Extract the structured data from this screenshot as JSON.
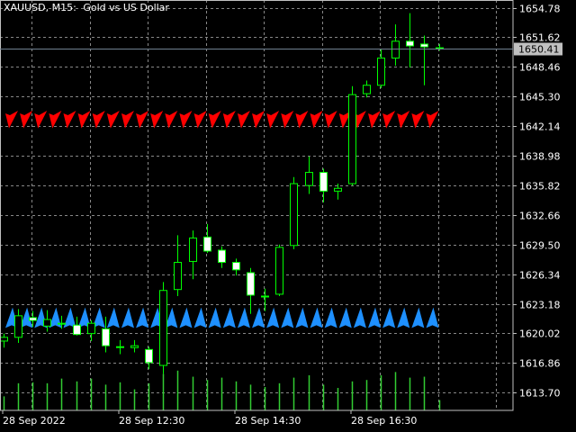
{
  "header": {
    "symbol": "XAUUSD, M15:",
    "description": "Gold vs US Dollar"
  },
  "chart_data": {
    "type": "candlestick",
    "ylim": [
      1611.8,
      1655.6
    ],
    "y_ticks": [
      "1654.78",
      "1651.62",
      "1648.46",
      "1645.30",
      "1642.14",
      "1638.98",
      "1635.82",
      "1632.66",
      "1629.50",
      "1626.34",
      "1623.18",
      "1620.02",
      "1616.86",
      "1613.70"
    ],
    "x_ticks": [
      "28 Sep 2022",
      "28 Sep 12:30",
      "28 Sep 14:30",
      "28 Sep 16:30"
    ],
    "current_price": "1650.41",
    "grid": true,
    "colors": {
      "background": "#000000",
      "grid": "#c0c0c0",
      "bull_body": "#000000",
      "bear_body": "#ffffff",
      "candle_outline": "#00ff00",
      "volume": "#32cd32",
      "upper_arrows": "#ff0000",
      "lower_arrows": "#1e90ff",
      "price_line": "#708090",
      "axis_text": "#ffffff"
    },
    "candles": [
      {
        "o": 1619.2,
        "h": 1620.0,
        "l": 1618.5,
        "c": 1619.6
      },
      {
        "o": 1619.6,
        "h": 1622.6,
        "l": 1619.0,
        "c": 1621.9
      },
      {
        "o": 1621.7,
        "h": 1622.4,
        "l": 1620.7,
        "c": 1621.4
      },
      {
        "o": 1620.8,
        "h": 1622.5,
        "l": 1620.2,
        "c": 1621.5
      },
      {
        "o": 1621.0,
        "h": 1621.9,
        "l": 1620.5,
        "c": 1621.1
      },
      {
        "o": 1620.9,
        "h": 1621.8,
        "l": 1619.8,
        "c": 1619.9
      },
      {
        "o": 1620.0,
        "h": 1621.4,
        "l": 1619.2,
        "c": 1621.1
      },
      {
        "o": 1620.5,
        "h": 1621.8,
        "l": 1618.0,
        "c": 1618.7
      },
      {
        "o": 1618.6,
        "h": 1619.3,
        "l": 1617.8,
        "c": 1618.6
      },
      {
        "o": 1618.5,
        "h": 1619.3,
        "l": 1618.0,
        "c": 1618.7
      },
      {
        "o": 1618.3,
        "h": 1618.6,
        "l": 1616.2,
        "c": 1616.9
      },
      {
        "o": 1616.6,
        "h": 1625.5,
        "l": 1615.7,
        "c": 1624.6
      },
      {
        "o": 1624.7,
        "h": 1630.5,
        "l": 1624.0,
        "c": 1627.6
      },
      {
        "o": 1627.7,
        "h": 1631.0,
        "l": 1625.8,
        "c": 1630.2
      },
      {
        "o": 1630.3,
        "h": 1631.7,
        "l": 1628.6,
        "c": 1628.8
      },
      {
        "o": 1628.9,
        "h": 1629.3,
        "l": 1627.0,
        "c": 1627.6
      },
      {
        "o": 1627.6,
        "h": 1628.0,
        "l": 1626.2,
        "c": 1626.8
      },
      {
        "o": 1626.5,
        "h": 1627.0,
        "l": 1622.1,
        "c": 1624.1
      },
      {
        "o": 1624.0,
        "h": 1624.8,
        "l": 1622.4,
        "c": 1624.0
      },
      {
        "o": 1624.2,
        "h": 1629.5,
        "l": 1624.0,
        "c": 1629.2
      },
      {
        "o": 1629.4,
        "h": 1636.7,
        "l": 1629.0,
        "c": 1636.0
      },
      {
        "o": 1635.8,
        "h": 1638.9,
        "l": 1634.9,
        "c": 1637.2
      },
      {
        "o": 1637.2,
        "h": 1637.6,
        "l": 1634.0,
        "c": 1635.2
      },
      {
        "o": 1635.2,
        "h": 1636.0,
        "l": 1634.3,
        "c": 1635.5
      },
      {
        "o": 1636.0,
        "h": 1646.4,
        "l": 1635.8,
        "c": 1645.5
      },
      {
        "o": 1645.6,
        "h": 1647.0,
        "l": 1645.2,
        "c": 1646.5
      },
      {
        "o": 1646.5,
        "h": 1650.3,
        "l": 1646.2,
        "c": 1649.4
      },
      {
        "o": 1649.4,
        "h": 1653.0,
        "l": 1648.6,
        "c": 1651.2
      },
      {
        "o": 1651.2,
        "h": 1654.2,
        "l": 1648.4,
        "c": 1650.7
      },
      {
        "o": 1650.9,
        "h": 1651.8,
        "l": 1646.5,
        "c": 1650.6
      },
      {
        "o": 1650.5,
        "h": 1650.9,
        "l": 1650.2,
        "c": 1650.4
      }
    ],
    "volumes": [
      0.3,
      0.58,
      0.6,
      0.58,
      0.68,
      0.62,
      0.68,
      0.55,
      0.6,
      0.45,
      0.58,
      0.78,
      0.85,
      0.72,
      0.65,
      0.7,
      0.62,
      0.55,
      0.5,
      0.58,
      0.7,
      0.75,
      0.55,
      0.48,
      0.62,
      0.65,
      0.75,
      0.82,
      0.7,
      0.72,
      0.22
    ],
    "upper_arrow_band": {
      "low": 1641.9,
      "high": 1643.5
    },
    "lower_arrow_band": {
      "low": 1620.6,
      "high": 1622.5
    }
  }
}
